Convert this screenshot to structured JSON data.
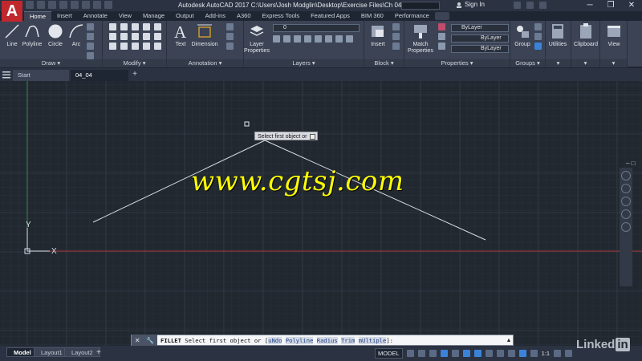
{
  "app": {
    "logo_letter": "A",
    "window_title": "Autodesk AutoCAD 2017   C:\\Users\\Josh Modglin\\Desktop\\Exercise Files\\Ch 04\\04_04.dwg",
    "sign_in": "Sign In",
    "window_controls": [
      "─",
      "❐",
      "✕"
    ]
  },
  "ribbon": {
    "tabs": [
      "Home",
      "Insert",
      "Annotate",
      "View",
      "Manage",
      "Output",
      "Add-ins",
      "A360",
      "Express Tools",
      "Featured Apps",
      "BIM 360",
      "Performance"
    ],
    "active_tab": "Home",
    "panels": {
      "draw": {
        "title": "Draw ▾",
        "tools": [
          "Line",
          "Polyline",
          "Circle",
          "Arc"
        ]
      },
      "modify": {
        "title": "Modify ▾"
      },
      "annotation": {
        "title": "Annotation ▾",
        "tools": [
          "Text",
          "Dimension"
        ]
      },
      "layers": {
        "title": "Layers ▾",
        "layer_tool": "Layer\nProperties",
        "current_layer": "0"
      },
      "block": {
        "title": "Block ▾",
        "tool": "Insert"
      },
      "properties": {
        "title": "Properties ▾",
        "tool": "Match\nProperties",
        "color": "ByLayer",
        "linetype": "ByLayer",
        "lineweight": "ByLayer"
      },
      "groups": {
        "title": "Groups ▾",
        "tool": "Group"
      },
      "utilities": {
        "tool": "Utilities"
      },
      "clipboard": {
        "tool": "Clipboard"
      },
      "view": {
        "tool": "View"
      }
    }
  },
  "file_tabs": [
    "Start",
    "04_04"
  ],
  "active_file_tab": "04_04",
  "viewport_label": "",
  "drawing": {
    "tooltip": "Select first object or",
    "ucs_y": "Y",
    "ucs_x": "X",
    "watermark": "www.cgtsj.com"
  },
  "command_line": {
    "command": "FILLET",
    "prompt": "Select first object or [",
    "options": [
      "uNdo",
      "Polyline",
      "Radius",
      "Trim",
      "mUltiple"
    ],
    "suffix": "]:"
  },
  "layout_tabs": [
    "Model",
    "Layout1",
    "Layout2"
  ],
  "active_layout": "Model",
  "status": {
    "model": "MODEL",
    "scale": "1:1"
  },
  "branding": {
    "linkedin_word": "Linked",
    "linkedin_in": "in"
  },
  "colors": {
    "accent_red": "#c0282e",
    "ribbon_bg": "#3b4354",
    "canvas_bg": "#212830",
    "watermark": "#ffff00",
    "ucs_y_axis": "#2f8a43",
    "ucs_x_axis": "#a33232"
  }
}
